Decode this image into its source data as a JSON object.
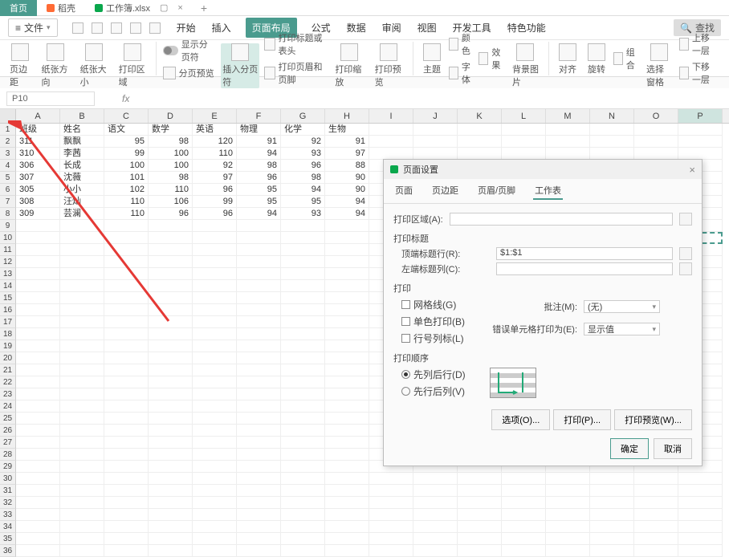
{
  "topTabs": {
    "home": "首页",
    "daoke": "稻壳",
    "workbook": "工作簿.xlsx"
  },
  "fileMenu": "文件",
  "menuTabs": {
    "start": "开始",
    "insert": "插入",
    "pageLayout": "页面布局",
    "formula": "公式",
    "data": "数据",
    "review": "审阅",
    "view": "视图",
    "devTools": "开发工具",
    "special": "特色功能",
    "search": "查找"
  },
  "toolbar": {
    "margins": "页边距",
    "orientation": "纸张方向",
    "size": "纸张大小",
    "printArea": "打印区域",
    "showBreaks": "显示分页符",
    "breakPreview": "分页预览",
    "insertBreak": "插入分页符",
    "printTitlesHeader": "打印标题或表头",
    "printHeaderFooter": "打印页眉和页脚",
    "printZoom": "打印缩放",
    "printPreview": "打印预览",
    "theme": "主题",
    "colors": "颜色",
    "fonts": "字体",
    "effects": "效果",
    "bgImage": "背景图片",
    "align": "对齐",
    "rotate": "旋转",
    "group": "组合",
    "selectPane": "选择窗格",
    "moveUp": "上移一层",
    "moveDown": "下移一层"
  },
  "nameBox": "P10",
  "headers": [
    "班级",
    "姓名",
    "语文",
    "数学",
    "英语",
    "物理",
    "化学",
    "生物"
  ],
  "rows": [
    [
      "311",
      "飘飘",
      "95",
      "98",
      "120",
      "91",
      "92",
      "91"
    ],
    [
      "310",
      "李茜",
      "99",
      "100",
      "110",
      "94",
      "93",
      "97"
    ],
    [
      "306",
      "长成",
      "100",
      "100",
      "92",
      "98",
      "96",
      "88"
    ],
    [
      "307",
      "沈薇",
      "101",
      "98",
      "97",
      "96",
      "98",
      "90"
    ],
    [
      "305",
      "小小",
      "102",
      "110",
      "96",
      "95",
      "94",
      "90"
    ],
    [
      "308",
      "汪灿",
      "110",
      "106",
      "99",
      "95",
      "95",
      "94"
    ],
    [
      "309",
      "芸澜",
      "110",
      "96",
      "96",
      "94",
      "93",
      "94"
    ]
  ],
  "cols": [
    "A",
    "B",
    "C",
    "D",
    "E",
    "F",
    "G",
    "H",
    "I",
    "J",
    "K",
    "L",
    "M",
    "N",
    "O",
    "P"
  ],
  "dialog": {
    "title": "页面设置",
    "tabs": {
      "page": "页面",
      "margins": "页边距",
      "headerFooter": "页眉/页脚",
      "sheet": "工作表"
    },
    "printAreaLabel": "打印区域(A):",
    "printTitlesSection": "打印标题",
    "topRowLabel": "顶端标题行(R):",
    "topRowValue": "$1:$1",
    "leftColLabel": "左端标题列(C):",
    "printSection": "打印",
    "gridlines": "网格线(G)",
    "monochrome": "单色打印(B)",
    "rowColHeaders": "行号列标(L)",
    "commentsLabel": "批注(M):",
    "commentsValue": "(无)",
    "errorsLabel": "错误单元格打印为(E):",
    "errorsValue": "显示值",
    "orderSection": "打印顺序",
    "colThenRow": "先列后行(D)",
    "rowThenCol": "先行后列(V)",
    "optionsBtn": "选项(O)...",
    "printBtn": "打印(P)...",
    "previewBtn": "打印预览(W)...",
    "ok": "确定",
    "cancel": "取消"
  }
}
